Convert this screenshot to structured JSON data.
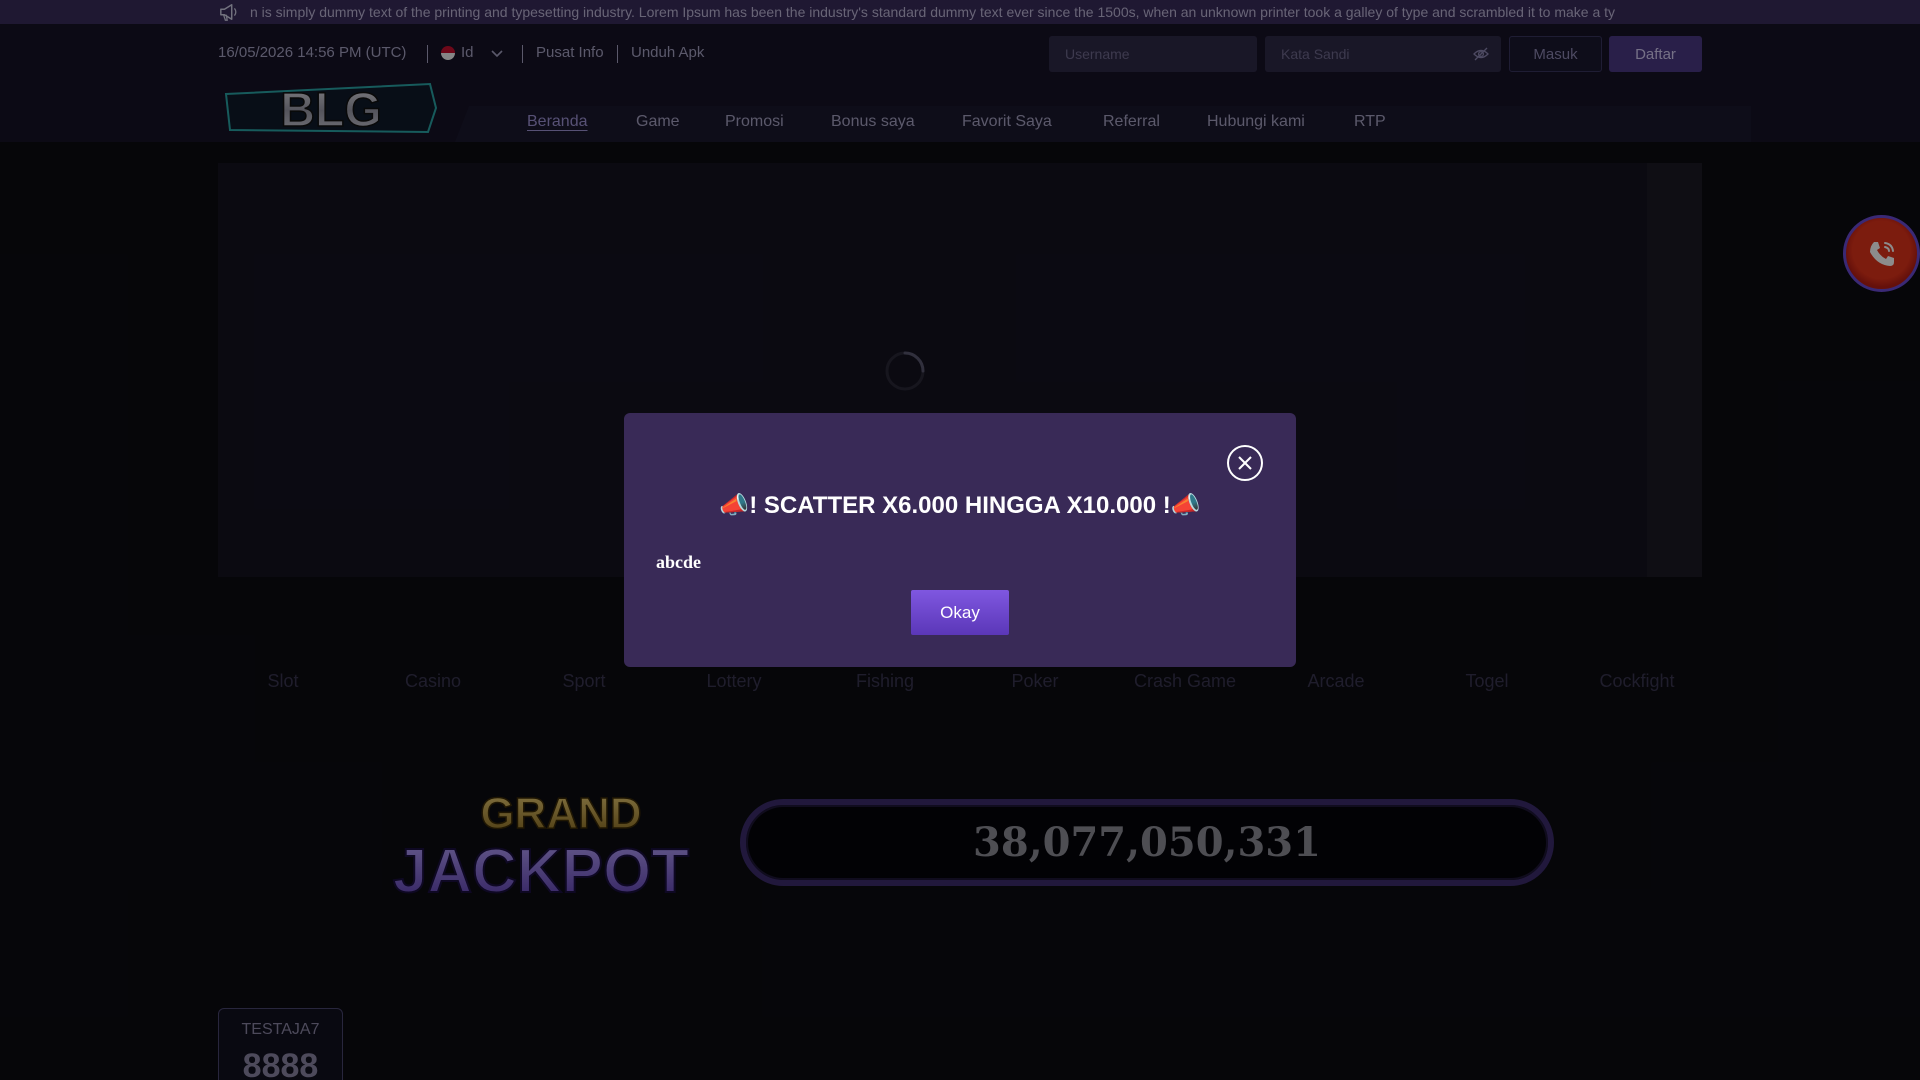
{
  "marquee": {
    "icon": "megaphone-icon",
    "text": "n is simply dummy text of the printing and typesetting industry. Lorem Ipsum has been the industry's standard dummy text ever since the 1500s, when an unknown printer took a galley of type and scrambled it to make a ty"
  },
  "header": {
    "datetime": "16/05/2026 14:56 PM (UTC)",
    "language": "Id",
    "links": {
      "info": "Pusat Info",
      "download": "Unduh Apk"
    },
    "login": {
      "username_placeholder": "Username",
      "password_placeholder": "Kata Sandi",
      "login_label": "Masuk",
      "register_label": "Daftar"
    },
    "logo_text": "BLG"
  },
  "nav": {
    "items": [
      "Beranda",
      "Game",
      "Promosi",
      "Bonus saya",
      "Favorit Saya",
      "Referral",
      "Hubungi kami",
      "RTP"
    ],
    "active": "Beranda"
  },
  "categories": [
    "Slot",
    "Casino",
    "Sport",
    "Lottery",
    "Fishing",
    "Poker",
    "Crash Game",
    "Arcade",
    "Togel",
    "Cockfight"
  ],
  "jackpot": {
    "title_top": "GRAND",
    "title_bottom": "JACKPOT",
    "value": "38,077,050,331"
  },
  "user_card": {
    "name": "TESTAJA7",
    "value": "8888"
  },
  "modal": {
    "title": "📣! SCATTER X6.000 HINGGA X10.000 !📣",
    "body": "abcde",
    "okay_label": "Okay"
  },
  "colors": {
    "accent": "#5b37b8",
    "modal_bg": "#392a57",
    "call_button": "#e2331a"
  }
}
